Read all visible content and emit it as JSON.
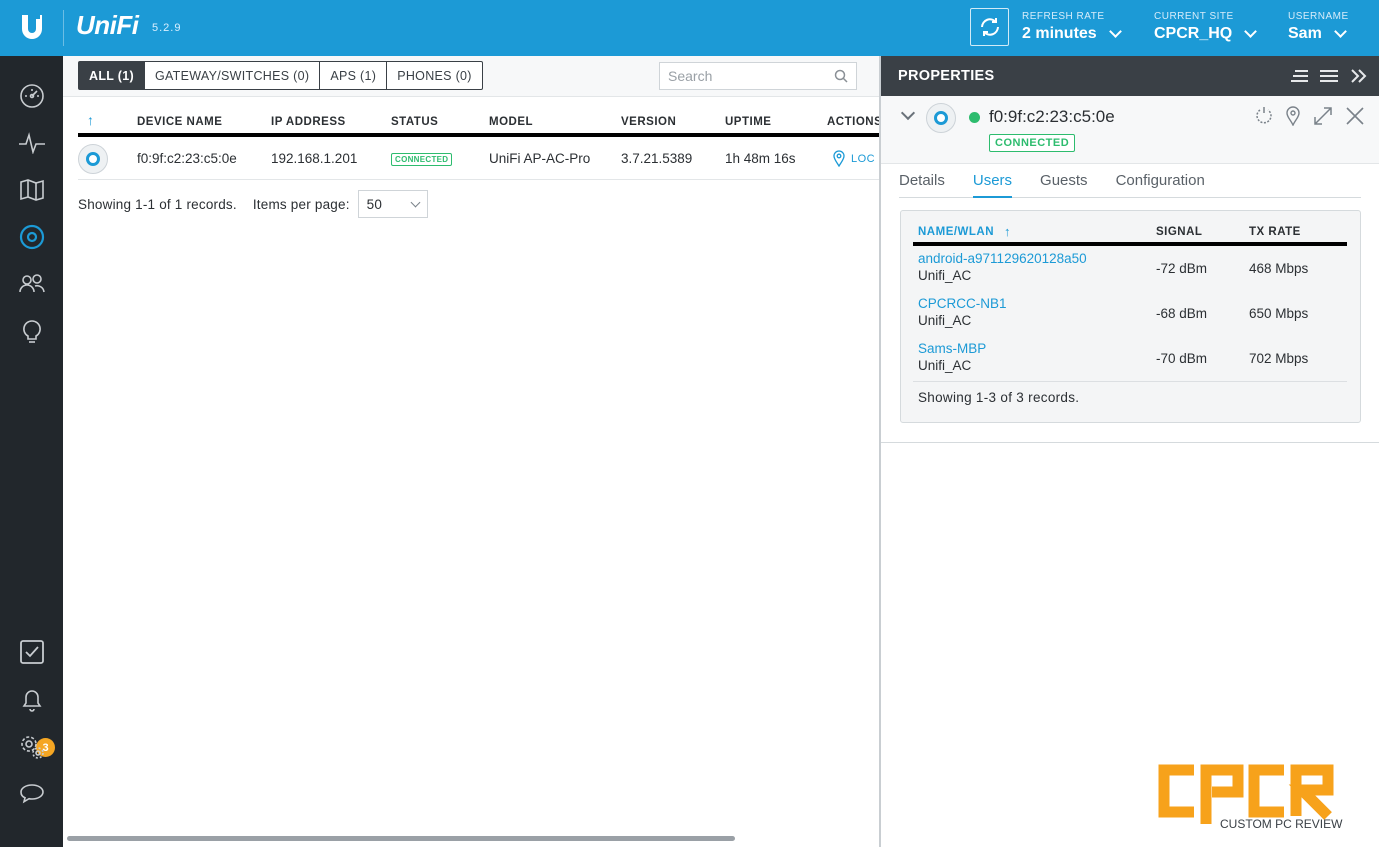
{
  "topbar": {
    "brand": "UniFi",
    "version": "5.2.9",
    "refresh_rate_label": "REFRESH RATE",
    "refresh_rate_value": "2 minutes",
    "current_site_label": "CURRENT SITE",
    "current_site_value": "CPCR_HQ",
    "username_label": "USERNAME",
    "username_value": "Sam"
  },
  "sidebar": {
    "items": [
      {
        "icon": "dashboard-icon"
      },
      {
        "icon": "statistics-icon"
      },
      {
        "icon": "map-icon"
      },
      {
        "icon": "devices-icon"
      },
      {
        "icon": "clients-icon"
      },
      {
        "icon": "insights-icon"
      }
    ],
    "bottom_items": [
      {
        "icon": "events-checkbox-icon"
      },
      {
        "icon": "alerts-bell-icon"
      },
      {
        "icon": "settings-icon"
      },
      {
        "icon": "chat-icon"
      }
    ],
    "alerts_count": "3"
  },
  "filters": {
    "tabs": [
      "ALL (1)",
      "GATEWAY/SWITCHES (0)",
      "APS (1)",
      "PHONES (0)"
    ],
    "active_tab": 0,
    "search_placeholder": "Search"
  },
  "device_table": {
    "columns": [
      "DEVICE NAME",
      "IP ADDRESS",
      "STATUS",
      "MODEL",
      "VERSION",
      "UPTIME",
      "ACTIONS"
    ],
    "sort_arrow": "↑",
    "rows": [
      {
        "name": "f0:9f:c2:23:c5:0e",
        "ip": "192.168.1.201",
        "status": "CONNECTED",
        "model": "UniFi AP-AC-Pro",
        "version": "3.7.21.5389",
        "uptime": "1h 48m 16s",
        "action": "LOC"
      }
    ],
    "footer_text": "Showing 1-1 of 1 records.",
    "items_per_page_label": "Items per page:",
    "items_per_page_value": "50"
  },
  "properties": {
    "title": "PROPERTIES",
    "device_name": "f0:9f:c2:23:c5:0e",
    "status": "CONNECTED",
    "tabs": [
      "Details",
      "Users",
      "Guests",
      "Configuration"
    ],
    "active_tab": 1,
    "users_table": {
      "columns": [
        "NAME/WLAN",
        "SIGNAL",
        "TX RATE"
      ],
      "sort_arrow": "↑",
      "rows": [
        {
          "name": "android-a971129620128a50",
          "wlan": "Unifi_AC",
          "signal": "-72 dBm",
          "tx_rate": "468 Mbps"
        },
        {
          "name": "CPCRCC-NB1",
          "wlan": "Unifi_AC",
          "signal": "-68 dBm",
          "tx_rate": "650 Mbps"
        },
        {
          "name": "Sams-MBP",
          "wlan": "Unifi_AC",
          "signal": "-70 dBm",
          "tx_rate": "702 Mbps"
        }
      ],
      "footer_text": "Showing 1-3 of 3 records."
    }
  },
  "watermark": {
    "logo_text": "CPCR",
    "caption": "CUSTOM PC REVIEW"
  },
  "colors": {
    "topbar": "#1c9ad6",
    "sidebar": "#22272c",
    "accent": "#1c9ad6",
    "connected": "#2dbc6e",
    "badge": "#f5a623",
    "watermark": "#f7a21b"
  }
}
